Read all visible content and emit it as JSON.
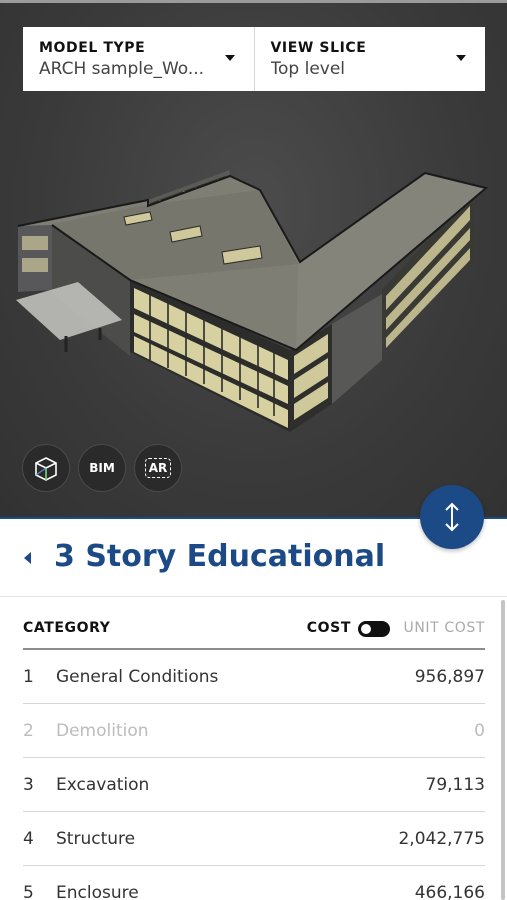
{
  "filters": {
    "model_type": {
      "label": "MODEL TYPE",
      "value": "ARCH sample_Wo..."
    },
    "view_slice": {
      "label": "VIEW SLICE",
      "value": "Top level"
    }
  },
  "viewer": {
    "tools": [
      {
        "name": "cube-view",
        "icon": "cube-icon"
      },
      {
        "name": "bim",
        "label": "BIM"
      },
      {
        "name": "ar",
        "label": "AR"
      }
    ],
    "fab_icon": "vertical-resize-icon"
  },
  "project": {
    "title": "3 Story Educational"
  },
  "table": {
    "header": {
      "category": "CATEGORY",
      "cost": "COST",
      "unit_cost": "UNIT COST"
    },
    "rows": [
      {
        "num": "1",
        "name": "General Conditions",
        "value": "956,897"
      },
      {
        "num": "2",
        "name": "Demolition",
        "value": "0"
      },
      {
        "num": "3",
        "name": "Excavation",
        "value": "79,113"
      },
      {
        "num": "4",
        "name": "Structure",
        "value": "2,042,775"
      },
      {
        "num": "5",
        "name": "Enclosure",
        "value": "466,166"
      }
    ]
  },
  "colors": {
    "accent": "#1c4a86",
    "viewer_bg": "#3a3a3a"
  }
}
